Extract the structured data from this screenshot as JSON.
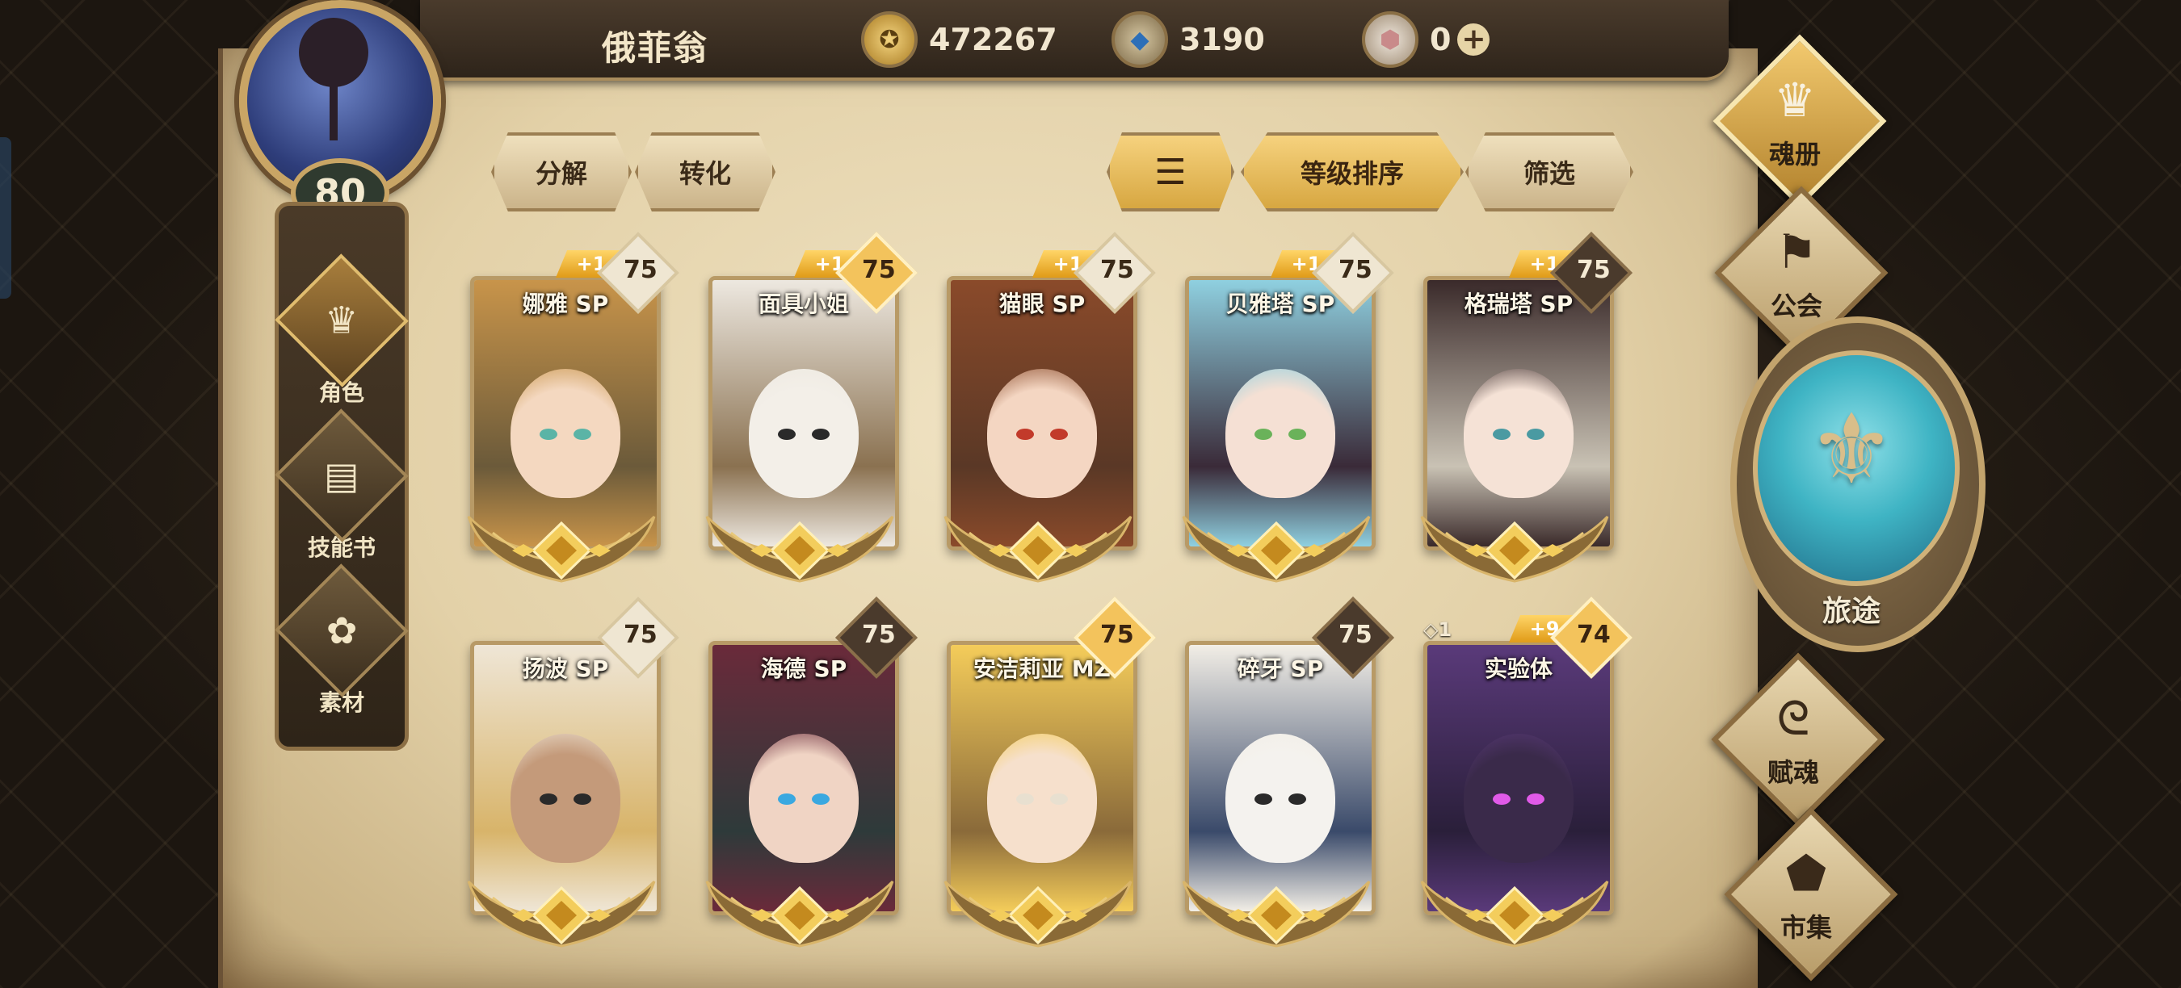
{
  "header": {
    "player_name": "俄菲翁",
    "player_level": "80",
    "currencies": [
      {
        "name": "gold-coin",
        "icon": "coin-icon",
        "value": "472267"
      },
      {
        "name": "blue-crystal",
        "icon": "crystal-icon",
        "value": "3190"
      },
      {
        "name": "gem",
        "icon": "gem-icon",
        "value": "0",
        "has_add": true
      }
    ]
  },
  "left_nav": [
    {
      "label": "角色",
      "icon": "helmet-icon",
      "active": true
    },
    {
      "label": "技能书",
      "icon": "book-icon",
      "active": false
    },
    {
      "label": "素材",
      "icon": "material-icon",
      "active": false
    }
  ],
  "toolbar": {
    "decompose": "分解",
    "convert": "转化",
    "sort_order_icon": "sort-icon",
    "sort_by_level": "等级排序",
    "filter": "筛选"
  },
  "cards": [
    {
      "name": "娜雅 SP",
      "level": "75",
      "bonus": "+1",
      "level_style": "light",
      "hair": "#c8944a",
      "bg": "#6b5a3a",
      "skin": "#f4d8c0",
      "eyes": "#5bb4a6"
    },
    {
      "name": "面具小姐",
      "level": "75",
      "bonus": "+1",
      "level_style": "gold",
      "hair": "#ede8e0",
      "bg": "#8a7150",
      "skin": "#f3efe8",
      "eyes": "#2a2a2a"
    },
    {
      "name": "猫眼 SP",
      "level": "75",
      "bonus": "+1",
      "level_style": "light",
      "hair": "#8a4a2a",
      "bg": "#5a3826",
      "skin": "#f4d6c2",
      "eyes": "#c23a2a"
    },
    {
      "name": "贝雅塔 SP",
      "level": "75",
      "bonus": "+1",
      "level_style": "light",
      "hair": "#8fd0e0",
      "bg": "#3a2a38",
      "skin": "#f5e0d4",
      "eyes": "#6ab25a"
    },
    {
      "name": "格瑞塔 SP",
      "level": "75",
      "bonus": "+1",
      "level_style": "dark",
      "hair": "#3a2a2a",
      "bg": "#c9c2b4",
      "skin": "#f5e2d6",
      "eyes": "#4a9aa2"
    },
    {
      "name": "扬波 SP",
      "level": "75",
      "bonus": "",
      "level_style": "light",
      "hair": "#efe6d6",
      "bg": "#d8b46a",
      "skin": "#c49a7a",
      "eyes": "#2a2a2a"
    },
    {
      "name": "海德 SP",
      "level": "75",
      "bonus": "",
      "level_style": "dark",
      "hair": "#6a2a3a",
      "bg": "#2e3a3a",
      "skin": "#f0d4c4",
      "eyes": "#3aa8e0"
    },
    {
      "name": "安洁莉亚 MZ",
      "level": "75",
      "bonus": "",
      "level_style": "gold",
      "hair": "#f4cc5a",
      "bg": "#8a6a3a",
      "skin": "#f6e0cc",
      "eyes": "#e8e0d0"
    },
    {
      "name": "碎牙 SP",
      "level": "75",
      "bonus": "",
      "level_style": "dark",
      "hair": "#f2eee6",
      "bg": "#3a4a6a",
      "skin": "#f4f2ee",
      "eyes": "#2a2a2a"
    },
    {
      "name": "实验体",
      "level": "74",
      "bonus": "+9",
      "level_style": "gold",
      "hair": "#5a3a7a",
      "bg": "#2a1f3a",
      "skin": "#3a2a4a",
      "eyes": "#e05ae8",
      "diamond_count": "◇1"
    }
  ],
  "right_menu": [
    {
      "label": "魂册",
      "icon": "soul-book-icon",
      "active": true
    },
    {
      "label": "公会",
      "icon": "guild-icon",
      "active": false
    },
    {
      "label": "旅途",
      "icon": "journey-emblem-icon",
      "active": false
    },
    {
      "label": "赋魂",
      "icon": "spiral-icon",
      "active": false
    },
    {
      "label": "市集",
      "icon": "market-gem-icon",
      "active": false
    }
  ],
  "colors": {
    "accent_gold": "#e0b04a",
    "parchment": "#e8d8b4",
    "frame_brown": "#6b5236"
  }
}
